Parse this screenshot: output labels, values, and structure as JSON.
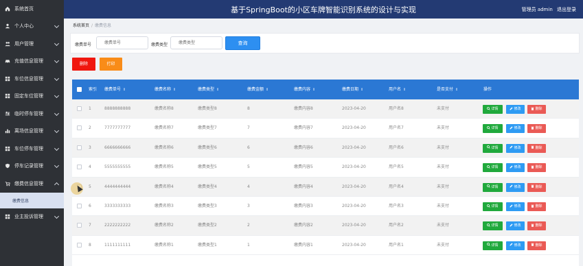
{
  "app": {
    "title": "基于SpringBoot的小区车牌智能识别系统的设计与实现",
    "user_label": "管理员 admin",
    "logout": "退出登录"
  },
  "sidebar": {
    "items": [
      {
        "label": "系统首页",
        "icon": "home-icon"
      },
      {
        "label": "个人中心",
        "icon": "person-icon",
        "chevron": "down"
      },
      {
        "label": "用户管理",
        "icon": "users-icon",
        "chevron": "down"
      },
      {
        "label": "充值信息管理",
        "icon": "car-icon",
        "chevron": "down"
      },
      {
        "label": "车位信息管理",
        "icon": "grid-icon",
        "chevron": "down"
      },
      {
        "label": "固定车位管理",
        "icon": "grid-icon",
        "chevron": "down"
      },
      {
        "label": "临时停车管理",
        "icon": "sliders-icon",
        "chevron": "down"
      },
      {
        "label": "离场信息管理",
        "icon": "bar-chart-icon",
        "chevron": "down"
      },
      {
        "label": "车位停车管理",
        "icon": "grid-icon",
        "chevron": "down"
      },
      {
        "label": "停车记录管理",
        "icon": "shield-icon",
        "chevron": "down"
      },
      {
        "label": "缴费信息管理",
        "icon": "cart-icon",
        "chevron": "up"
      },
      {
        "label": "业主投诉管理",
        "icon": "grid-icon",
        "chevron": "down"
      }
    ],
    "sub_item": "缴费信息"
  },
  "breadcrumb": {
    "home": "系统首页",
    "current": "缴费信息"
  },
  "search": {
    "field1_label": "缴费单号",
    "field1_placeholder": "缴费单号",
    "field2_label": "缴费类型",
    "field2_placeholder": "缴费类型",
    "query_button": "查询"
  },
  "actions": {
    "delete": "删除",
    "download": "打印"
  },
  "table": {
    "headers": [
      "索引",
      "缴费单号",
      "缴费名称",
      "缴费类型",
      "缴费金额",
      "缴费内容",
      "缴费日期",
      "用户名",
      "是否支付",
      "操作"
    ],
    "sort_indicator": "⇕",
    "row_actions": {
      "detail": "详情",
      "edit": "修改",
      "delete": "删除"
    },
    "rows": [
      {
        "index": "1",
        "no": "8888888888",
        "name": "缴费名称8",
        "type": "缴费类型8",
        "amount": "8",
        "content": "缴费内容8",
        "date": "2023-04-20",
        "user": "用户名8",
        "paid": "未支付"
      },
      {
        "index": "2",
        "no": "7777777777",
        "name": "缴费名称7",
        "type": "缴费类型7",
        "amount": "7",
        "content": "缴费内容7",
        "date": "2023-04-20",
        "user": "用户名7",
        "paid": "未支付"
      },
      {
        "index": "3",
        "no": "6666666666",
        "name": "缴费名称6",
        "type": "缴费类型6",
        "amount": "6",
        "content": "缴费内容6",
        "date": "2023-04-20",
        "user": "用户名6",
        "paid": "未支付"
      },
      {
        "index": "4",
        "no": "5555555555",
        "name": "缴费名称5",
        "type": "缴费类型5",
        "amount": "5",
        "content": "缴费内容5",
        "date": "2023-04-20",
        "user": "用户名5",
        "paid": "未支付"
      },
      {
        "index": "5",
        "no": "4444444444",
        "name": "缴费名称4",
        "type": "缴费类型4",
        "amount": "4",
        "content": "缴费内容4",
        "date": "2023-04-20",
        "user": "用户名4",
        "paid": "未支付"
      },
      {
        "index": "6",
        "no": "3333333333",
        "name": "缴费名称3",
        "type": "缴费类型3",
        "amount": "3",
        "content": "缴费内容3",
        "date": "2023-04-20",
        "user": "用户名3",
        "paid": "未支付"
      },
      {
        "index": "7",
        "no": "2222222222",
        "name": "缴费名称2",
        "type": "缴费类型2",
        "amount": "2",
        "content": "缴费内容2",
        "date": "2023-04-20",
        "user": "用户名2",
        "paid": "未支付"
      },
      {
        "index": "8",
        "no": "1111111111",
        "name": "缴费名称1",
        "type": "缴费类型1",
        "amount": "1",
        "content": "缴费内容1",
        "date": "2023-04-20",
        "user": "用户名1",
        "paid": "未支付"
      }
    ]
  },
  "colors": {
    "topbar": "#233a73",
    "sidebar": "#2e3136",
    "table_header": "#2b78d4",
    "detail_btn": "#20a93c",
    "edit_btn": "#2e9bf3",
    "delete_btn": "#ea5a55",
    "danger": "#f0170f",
    "warning": "#f98c18"
  }
}
